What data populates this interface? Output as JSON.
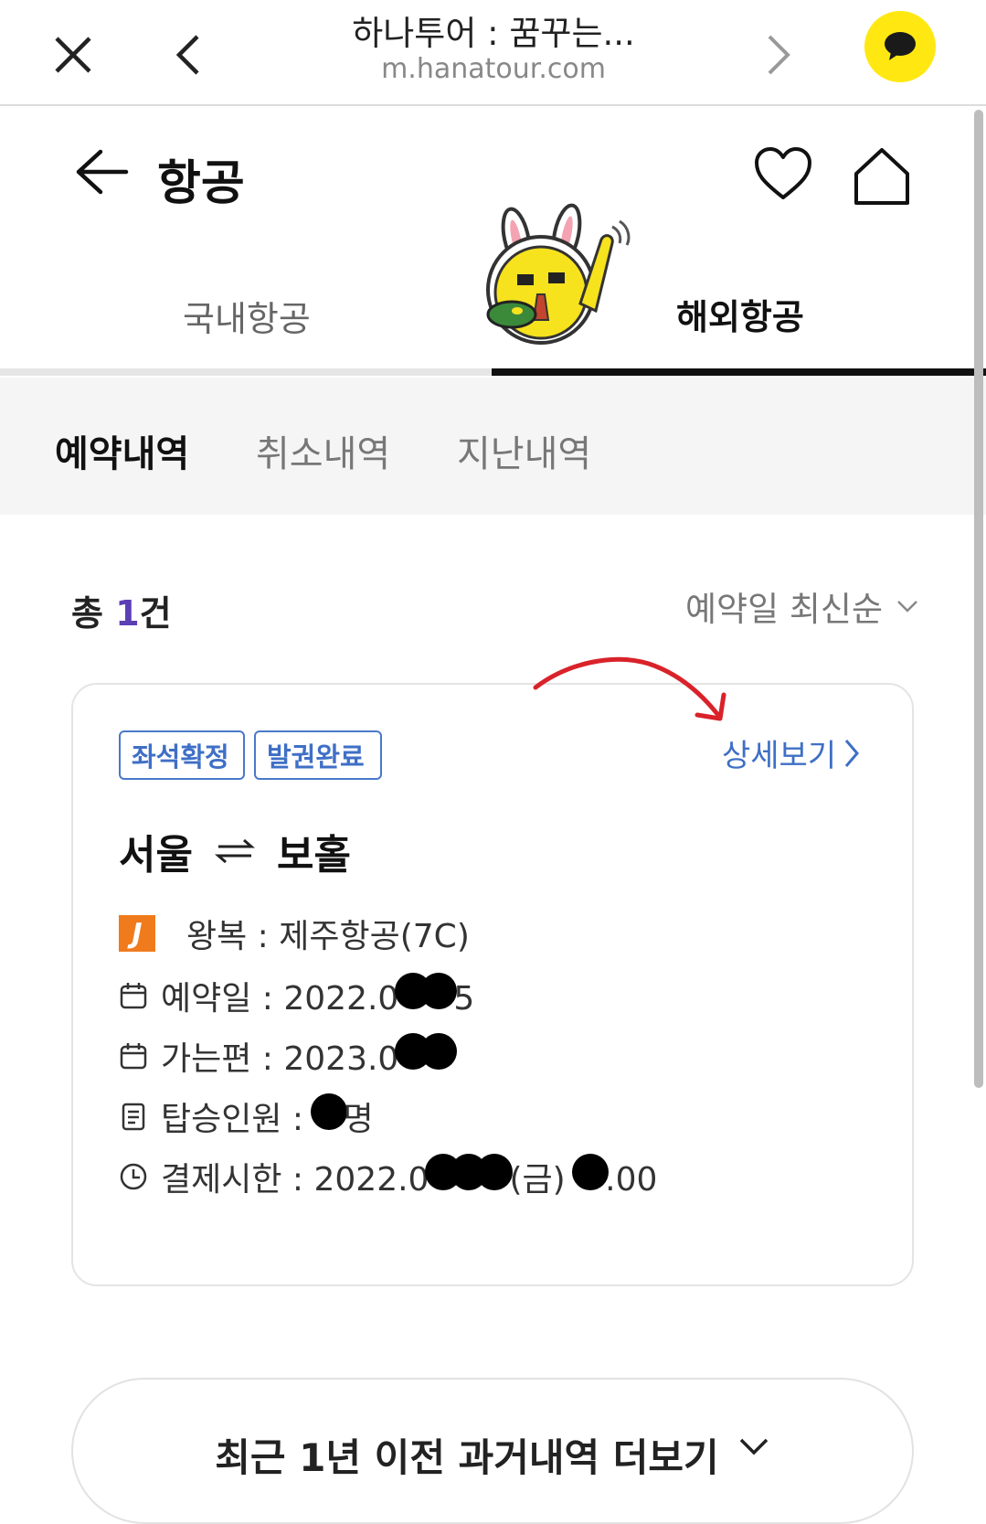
{
  "browser": {
    "title": "하나투어 : 꿈꾸는...",
    "domain": "m.hanatour.com",
    "icons": [
      "close-icon",
      "back-icon",
      "forward-icon",
      "kakao-chat-icon"
    ]
  },
  "header": {
    "title": "항공",
    "icons": [
      "arrow-left-icon",
      "heart-icon",
      "home-icon"
    ]
  },
  "tabs": [
    {
      "label": "국내항공",
      "active": false
    },
    {
      "label": "해외항공",
      "active": true
    }
  ],
  "subtabs": [
    {
      "label": "예약내역",
      "active": true
    },
    {
      "label": "취소내역",
      "active": false
    },
    {
      "label": "지난내역",
      "active": false
    }
  ],
  "summary": {
    "prefix": "총 ",
    "count": "1",
    "suffix": "건",
    "sort_label": "예약일 최신순"
  },
  "booking": {
    "badges": [
      "좌석확정",
      "발권완료"
    ],
    "detail_label": "상세보기",
    "origin": "서울",
    "destination": "보홀",
    "airline": "왕복 : 제주항공(7C)",
    "booking_date_prefix": "예약일 : 2022.0",
    "booking_date_suffix": "5",
    "departure_prefix": "가는편 : 2023.0",
    "passengers_prefix": "탑승인원 : ",
    "passengers_suffix": "명",
    "payment_prefix": "결제시한 : 2022.0",
    "payment_middle": "(금) ",
    "payment_suffix": ".00"
  },
  "more_button": {
    "label": "최근 1년 이전 과거내역 더보기"
  },
  "colors": {
    "accent_blue": "#3f6fc6",
    "count_purple": "#5b3fb5",
    "kakao_yellow": "#ffe812",
    "annotation_red": "#d9222a"
  }
}
